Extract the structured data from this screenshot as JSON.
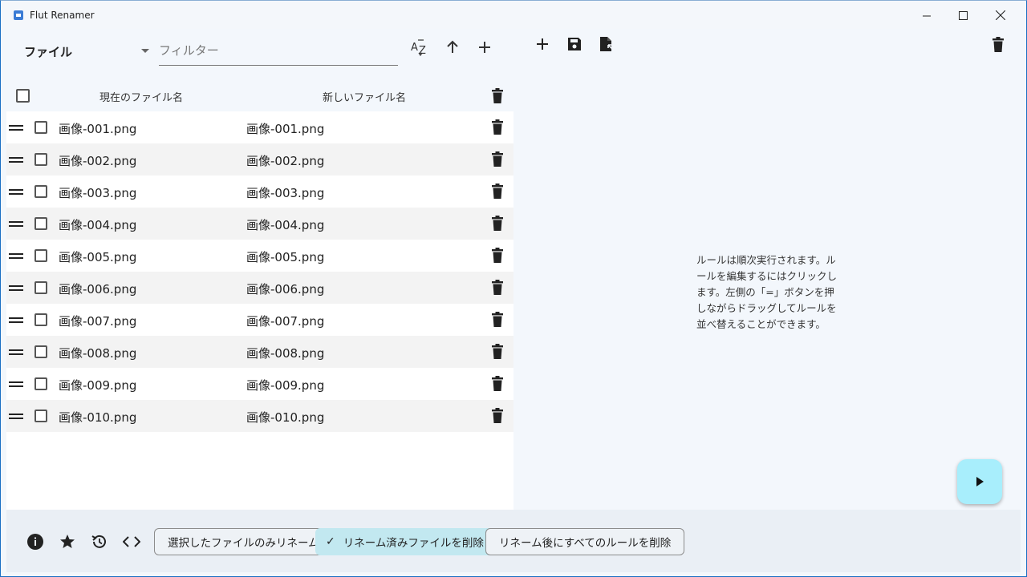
{
  "window": {
    "title": "Flut Renamer",
    "minimize": "—",
    "maximize": "☐",
    "close": "✕"
  },
  "toolbar": {
    "type_label": "ファイル",
    "filter_placeholder": "フィルター"
  },
  "columns": {
    "current": "現在のファイル名",
    "new": "新しいファイル名"
  },
  "files": [
    {
      "current": "画像-001.png",
      "new": "画像-001.png"
    },
    {
      "current": "画像-002.png",
      "new": "画像-002.png"
    },
    {
      "current": "画像-003.png",
      "new": "画像-003.png"
    },
    {
      "current": "画像-004.png",
      "new": "画像-004.png"
    },
    {
      "current": "画像-005.png",
      "new": "画像-005.png"
    },
    {
      "current": "画像-006.png",
      "new": "画像-006.png"
    },
    {
      "current": "画像-007.png",
      "new": "画像-007.png"
    },
    {
      "current": "画像-008.png",
      "new": "画像-008.png"
    },
    {
      "current": "画像-009.png",
      "new": "画像-009.png"
    },
    {
      "current": "画像-010.png",
      "new": "画像-010.png"
    }
  ],
  "rules": {
    "info": "ルールは順次実行されます。ルールを編集するにはクリックします。左側の「=」ボタンを押しながらドラッグしてルールを並べ替えることができます。"
  },
  "bottom": {
    "chip_selected_only": "選択したファイルのみリネーム",
    "chip_remove_renamed": "リネーム済みファイルを削除",
    "chip_clear_rules": "リネーム後にすべてのルールを削除"
  },
  "colors": {
    "accent": "#a8eefc",
    "chip_selected": "#c2e8f0",
    "title_bar": "#f4f7fb"
  },
  "icons": [
    "app-icon",
    "sort-az-icon",
    "arrow-up-icon",
    "add-icon",
    "save-icon",
    "load-rules-icon",
    "delete-icon",
    "drag-handle-icon",
    "info-icon",
    "star-icon",
    "history-icon",
    "code-icon",
    "play-icon",
    "check-icon"
  ]
}
